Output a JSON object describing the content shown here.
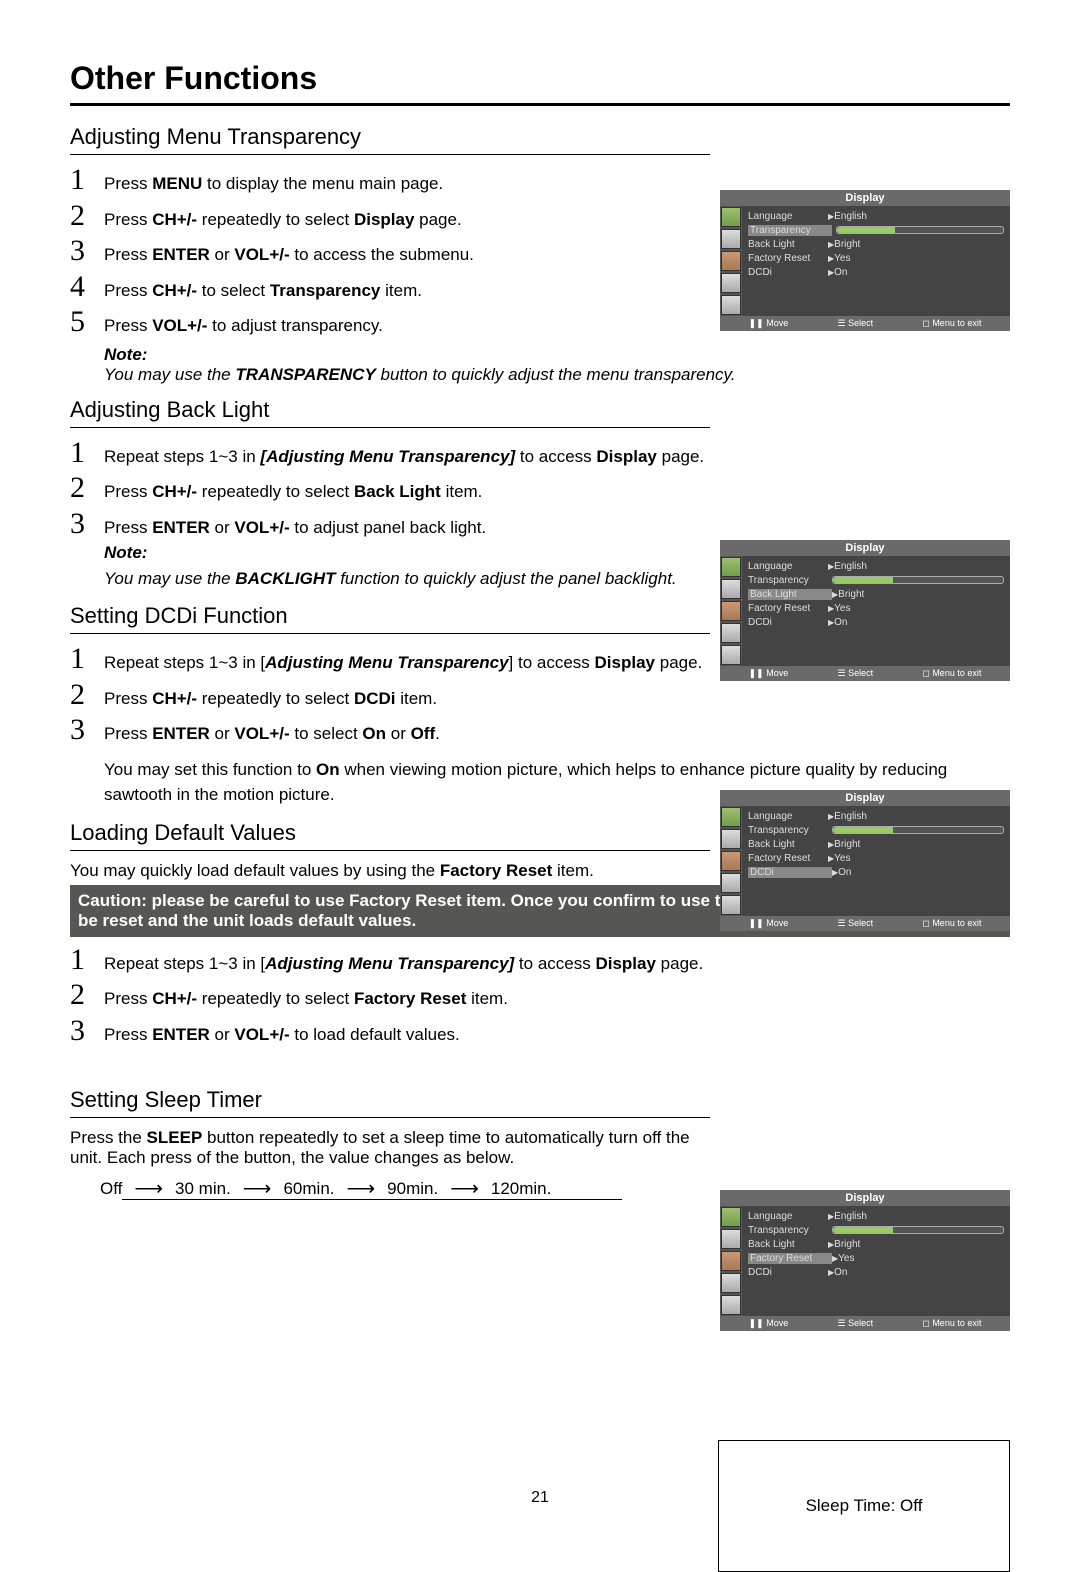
{
  "page_title": "Other Functions",
  "page_number": "21",
  "sections": {
    "transparency": {
      "heading": "Adjusting Menu Transparency",
      "steps": [
        {
          "n": "1",
          "pre": "Press ",
          "b": "MENU",
          "post": " to display the menu main page."
        },
        {
          "n": "2",
          "pre": "Press ",
          "b": "CH+/-",
          "post": " repeatedly to select ",
          "b2": "Display",
          "post2": " page."
        },
        {
          "n": "3",
          "pre": "Press ",
          "b": "ENTER",
          "mid": " or ",
          "b2": "VOL+/-",
          "post": " to access the submenu."
        },
        {
          "n": "4",
          "pre": "Press ",
          "b": "CH+/-",
          "post": " to select ",
          "b2": "Transparency",
          "post2": " item."
        },
        {
          "n": "5",
          "pre": "Press ",
          "b": "VOL+/-",
          "post": " to adjust transparency."
        }
      ],
      "note_title": "Note:",
      "note_pre": "You may use the ",
      "note_b": "TRANSPARENCY",
      "note_post": " button to quickly adjust the menu transparency."
    },
    "backlight": {
      "heading": "Adjusting Back Light",
      "steps": [
        {
          "n": "1",
          "pre": "Repeat steps 1~3 in ",
          "bi": "[Adjusting Menu Transparency]",
          "post": " to access ",
          "b2": "Display",
          "post2": " page."
        },
        {
          "n": "2",
          "pre": "Press ",
          "b": "CH+/-",
          "post": " repeatedly to select ",
          "b2": "Back Light",
          "post2": " item."
        },
        {
          "n": "3",
          "pre": "Press ",
          "b": "ENTER",
          "mid": " or ",
          "b2": "VOL+/-",
          "post": " to adjust panel back light."
        }
      ],
      "note_title": "Note:",
      "note_pre": "You may use the ",
      "note_b": "BACKLIGHT",
      "note_post": " function to quickly adjust the panel backlight."
    },
    "dcdi": {
      "heading": "Setting DCDi Function",
      "steps": [
        {
          "n": "1",
          "pre": "Repeat steps 1~3 in [",
          "bi": "Adjusting Menu Transparency",
          "post": "] to access ",
          "b2": "Display",
          "post2": " page."
        },
        {
          "n": "2",
          "pre": "Press ",
          "b": "CH+/-",
          "post": " repeatedly to select ",
          "b2": "DCDi",
          "post2": " item."
        },
        {
          "n": "3",
          "pre": "Press ",
          "b": "ENTER",
          "mid": " or ",
          "b2": "VOL+/-",
          "post": " to select ",
          "b3": "On",
          "or": " or ",
          "b4": "Off",
          "post2": "."
        }
      ],
      "extra_pre": "You may set this function to ",
      "extra_b": "On",
      "extra_post": " when viewing motion picture, which helps to enhance picture quality by reducing sawtooth in the motion picture."
    },
    "defaultv": {
      "heading": "Loading Default Values",
      "intro_pre": "You may quickly load default values by using the ",
      "intro_b": "Factory Reset",
      "intro_post": " item.",
      "caution": "Caution: please be careful to use Factory Reset item. Once you confirm to use this function all your settings will be reset and the unit loads default values.",
      "steps": [
        {
          "n": "1",
          "pre": "Repeat steps 1~3 in [",
          "bi": "Adjusting Menu Transparency]",
          "post": " to access ",
          "b2": "Display",
          "post2": " page."
        },
        {
          "n": "2",
          "pre": "Press ",
          "b": "CH+/-",
          "post": " repeatedly to select ",
          "b2": "Factory Reset",
          "post2": " item."
        },
        {
          "n": "3",
          "pre": "Press ",
          "b": "ENTER",
          "mid": " or ",
          "b2": "VOL+/-",
          "post": " to load default values."
        }
      ]
    },
    "sleep": {
      "heading": "Setting Sleep Timer",
      "body_pre": "Press the ",
      "body_b": "SLEEP",
      "body_post": " button repeatedly to set a sleep time to automatically turn off the unit. Each press of the button, the value changes as below.",
      "flow": [
        "Off",
        "30 min.",
        "60min.",
        "90min.",
        "120min."
      ],
      "box": "Sleep Time: Off"
    }
  },
  "osd": {
    "title": "Display",
    "rows": {
      "language": {
        "label": "Language",
        "val": "English"
      },
      "transparency": {
        "label": "Transparency"
      },
      "backlight": {
        "label": "Back Light",
        "val": "Bright"
      },
      "factory": {
        "label": "Factory Reset",
        "val": "Yes"
      },
      "dcdi": {
        "label": "DCDi",
        "val": "On"
      }
    },
    "foot": {
      "move": "Move",
      "select": "Select",
      "exit": "Menu to exit"
    }
  }
}
